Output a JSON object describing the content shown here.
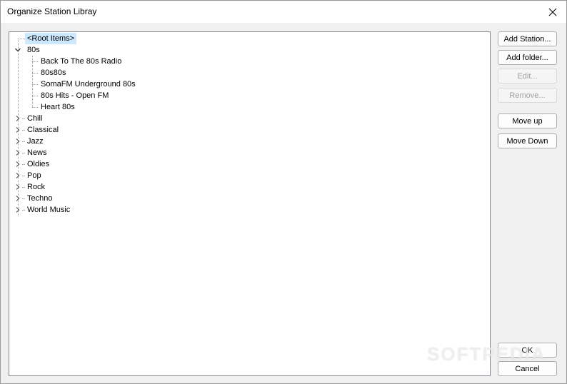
{
  "window": {
    "title": "Organize Station Libray"
  },
  "tree": {
    "root_label": "<Root Items>",
    "expanded_folder": {
      "label": "80s",
      "children": [
        "Back To The 80s Radio",
        "80s80s",
        "SomaFM Underground 80s",
        "80s Hits - Open FM",
        "Heart 80s"
      ]
    },
    "folders": [
      "Chill",
      "Classical",
      "Jazz",
      "News",
      "Oldies",
      "Pop",
      "Rock",
      "Techno",
      "World Music"
    ]
  },
  "buttons": {
    "add_station": "Add Station...",
    "add_folder": "Add folder...",
    "edit": "Edit...",
    "remove": "Remove...",
    "move_up": "Move up",
    "move_down": "Move Down",
    "ok": "OK",
    "cancel": "Cancel"
  },
  "watermark": "SOFTPEDIA",
  "icons": {
    "close": "close-icon",
    "expanded": "chevron-down-icon",
    "collapsed": "chevron-right-icon"
  },
  "colors": {
    "selection": "#cce8ff",
    "border": "#828790",
    "dialog_bg": "#f0f0f0"
  }
}
